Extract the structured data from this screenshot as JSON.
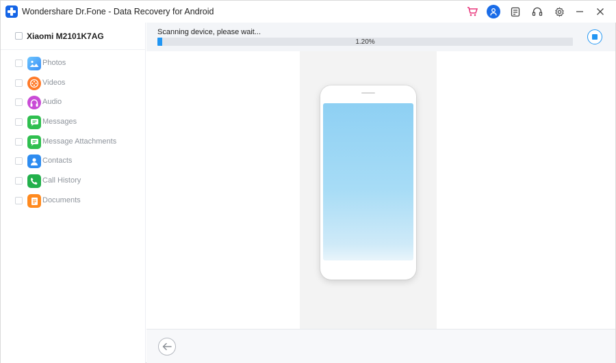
{
  "window": {
    "title": "Wondershare Dr.Fone - Data Recovery for Android"
  },
  "titlebar_icons": [
    "cart-icon",
    "user-icon",
    "feedback-icon",
    "headset-icon",
    "settings-icon",
    "minimize-icon",
    "close-icon"
  ],
  "sidebar": {
    "device_name": "Xiaomi M2101K7AG",
    "categories": [
      {
        "label": "Photos",
        "icon": "photos-icon",
        "color": "#4da6ff"
      },
      {
        "label": "Videos",
        "icon": "videos-icon",
        "color": "#ff7a29"
      },
      {
        "label": "Audio",
        "icon": "audio-icon",
        "color": "#c94bd6"
      },
      {
        "label": "Messages",
        "icon": "messages-icon",
        "color": "#2fbf4f"
      },
      {
        "label": "Message Attachments",
        "icon": "message-attachments-icon",
        "color": "#2fbf4f"
      },
      {
        "label": "Contacts",
        "icon": "contacts-icon",
        "color": "#2e8cf0"
      },
      {
        "label": "Call History",
        "icon": "call-history-icon",
        "color": "#22b04b"
      },
      {
        "label": "Documents",
        "icon": "documents-icon",
        "color": "#ff8a1f"
      }
    ]
  },
  "scan": {
    "status_text": "Scanning device, please wait...",
    "progress_label": "1.20%",
    "progress_fraction": 0.012
  },
  "colors": {
    "accent": "#2196f3",
    "brand": "#1565e6"
  }
}
